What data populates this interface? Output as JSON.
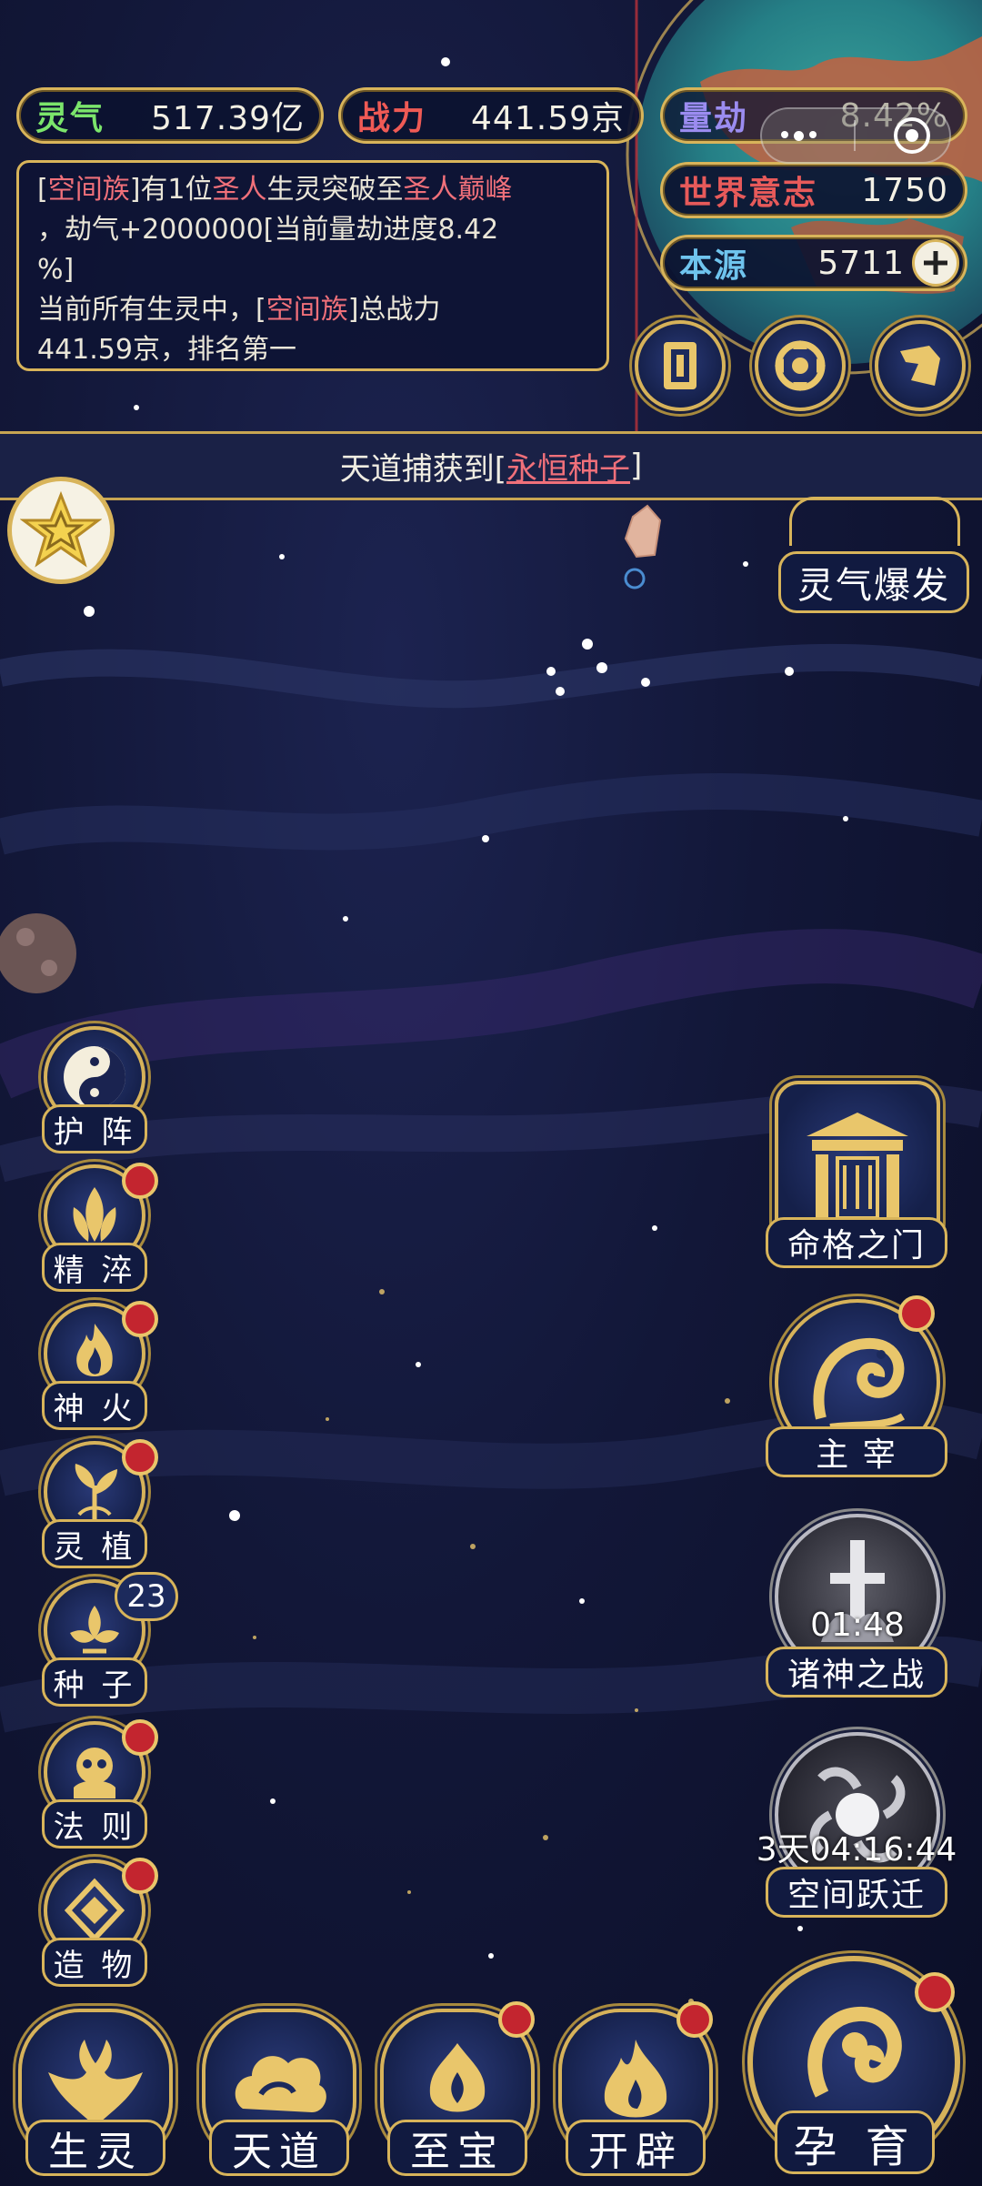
{
  "stats": {
    "lingqi": {
      "label": "灵气",
      "value": "517.39亿"
    },
    "zhanli": {
      "label": "战力",
      "value": "441.59京"
    },
    "liangjie": {
      "label": "量劫",
      "value": "8.42%"
    },
    "shijie": {
      "label": "世界意志",
      "value": "1750"
    },
    "benyuan": {
      "label": "本源",
      "value": "5711"
    }
  },
  "log": {
    "line1_a": "[",
    "line1_race": "空间族",
    "line1_b": "]有1位",
    "line1_rank": "圣人",
    "line1_c": "生灵突破至",
    "line1_rank2": "圣人巅峰",
    "line2": "，劫气+2000000[当前量劫进度8.42",
    "line3": "%]",
    "line4_a": "当前所有生灵中，[",
    "line4_race": "空间族",
    "line4_b": "]总战力",
    "line5": "441.59京，排名第一"
  },
  "banner": {
    "prefix": "天道捕获到[",
    "item": "永恒种子",
    "suffix": "]"
  },
  "top_right": {
    "burst_label": "灵气爆发"
  },
  "side_left": [
    {
      "label": "护 阵",
      "icon": "taiji-icon"
    },
    {
      "label": "精 淬",
      "icon": "lotus-flame-icon"
    },
    {
      "label": "神 火",
      "icon": "fire-icon"
    },
    {
      "label": "灵 植",
      "icon": "plant-icon"
    },
    {
      "label": "种 子",
      "icon": "seed-icon",
      "badge": "23"
    },
    {
      "label": "法 则",
      "icon": "rule-icon"
    },
    {
      "label": "造 物",
      "icon": "creation-icon"
    }
  ],
  "side_right": [
    {
      "label": "命格之门",
      "icon": "gate-icon"
    },
    {
      "label": "主 宰",
      "icon": "dragon-icon"
    },
    {
      "label": "诸神之战",
      "icon": "sword-icon",
      "timer": "01:48"
    },
    {
      "label": "空间跃迁",
      "icon": "portal-icon",
      "timer": "3天04:16:44"
    }
  ],
  "bottom_nav": [
    {
      "label": "生灵",
      "icon": "phoenix-icon"
    },
    {
      "label": "天道",
      "icon": "cloud-icon"
    },
    {
      "label": "至宝",
      "icon": "treasure-icon"
    },
    {
      "label": "开辟",
      "icon": "flame-icon"
    },
    {
      "label": "孕 育",
      "icon": "embryo-icon"
    }
  ],
  "colors": {
    "gold": "#d8b45a",
    "red_dot": "#c3252f",
    "highlight": "#f0707a"
  }
}
